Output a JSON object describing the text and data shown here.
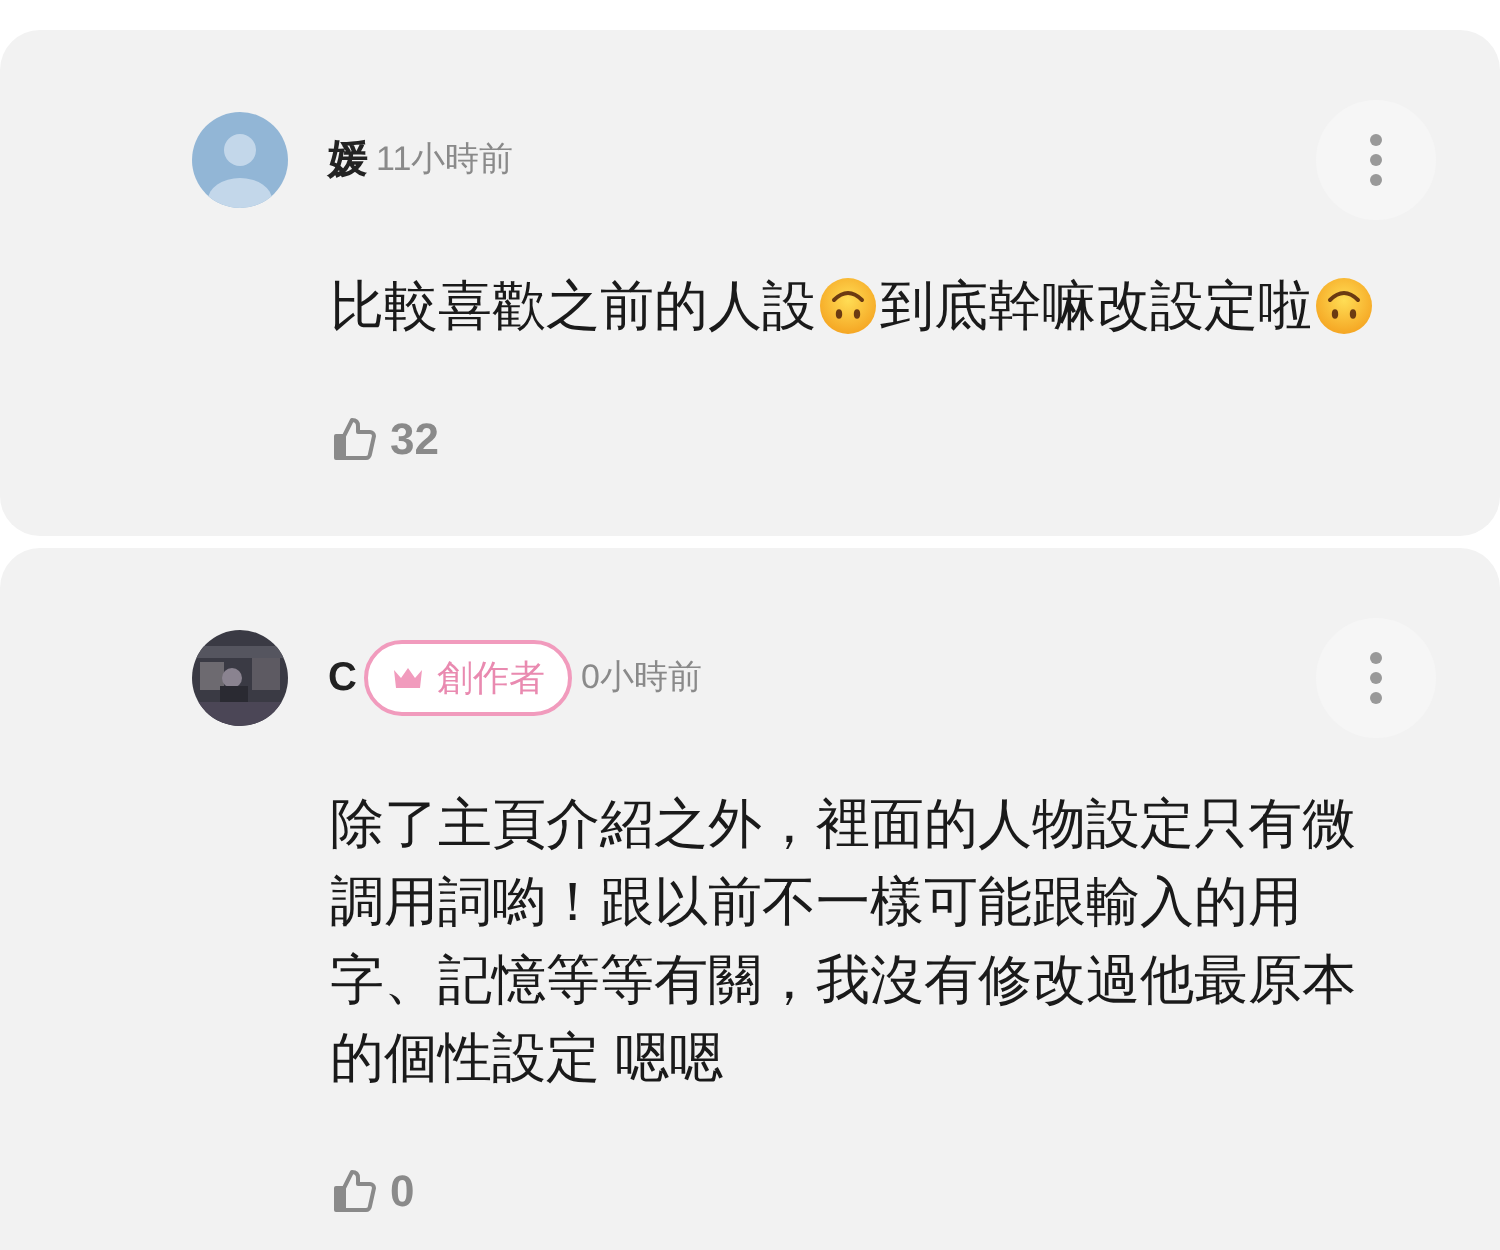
{
  "comments": [
    {
      "author": "媛",
      "avatar": {
        "kind": "default"
      },
      "time": "11小時前",
      "body": [
        {
          "kind": "text",
          "text": "比較喜歡之前的人設"
        },
        {
          "kind": "emoji"
        },
        {
          "kind": "text",
          "text": "到底幹嘛改設定啦"
        },
        {
          "kind": "emoji"
        }
      ],
      "likes": "32"
    },
    {
      "author": "C",
      "avatar": {
        "kind": "picture"
      },
      "creator_badge": "創作者",
      "time": "0小時前",
      "body": [
        {
          "kind": "text",
          "text": "除了主頁介紹之外，裡面的人物設定只有微調用詞喲！跟以前不一樣可能跟輸入的用字、記憶等等有關，我沒有修改過他最原本的個性設定 嗯嗯"
        }
      ],
      "likes": "0"
    }
  ]
}
